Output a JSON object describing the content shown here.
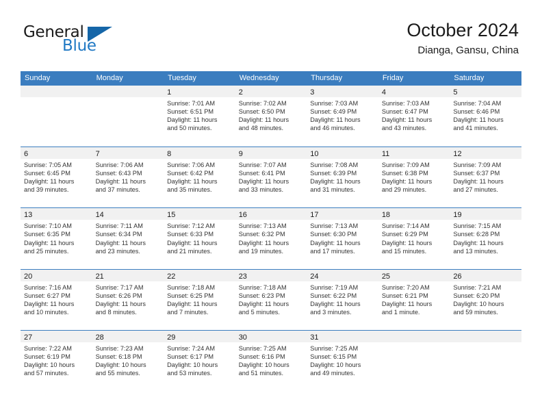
{
  "brand": {
    "name_line1": "General",
    "name_line2": "Blue",
    "accent_color": "#2079c4",
    "triangle_color": "#1566a8"
  },
  "header": {
    "title": "October 2024",
    "subtitle": "Dianga, Gansu, China"
  },
  "theme": {
    "header_bar_color": "#3b7dbf",
    "day_number_bar_color": "#f1f1f1",
    "text_color": "#333333"
  },
  "weekdays": [
    "Sunday",
    "Monday",
    "Tuesday",
    "Wednesday",
    "Thursday",
    "Friday",
    "Saturday"
  ],
  "weeks": [
    [
      {
        "day": "",
        "sunrise": "",
        "sunset": "",
        "daylight": "",
        "daylight2": ""
      },
      {
        "day": "",
        "sunrise": "",
        "sunset": "",
        "daylight": "",
        "daylight2": ""
      },
      {
        "day": "1",
        "sunrise": "Sunrise: 7:01 AM",
        "sunset": "Sunset: 6:51 PM",
        "daylight": "Daylight: 11 hours",
        "daylight2": "and 50 minutes."
      },
      {
        "day": "2",
        "sunrise": "Sunrise: 7:02 AM",
        "sunset": "Sunset: 6:50 PM",
        "daylight": "Daylight: 11 hours",
        "daylight2": "and 48 minutes."
      },
      {
        "day": "3",
        "sunrise": "Sunrise: 7:03 AM",
        "sunset": "Sunset: 6:49 PM",
        "daylight": "Daylight: 11 hours",
        "daylight2": "and 46 minutes."
      },
      {
        "day": "4",
        "sunrise": "Sunrise: 7:03 AM",
        "sunset": "Sunset: 6:47 PM",
        "daylight": "Daylight: 11 hours",
        "daylight2": "and 43 minutes."
      },
      {
        "day": "5",
        "sunrise": "Sunrise: 7:04 AM",
        "sunset": "Sunset: 6:46 PM",
        "daylight": "Daylight: 11 hours",
        "daylight2": "and 41 minutes."
      }
    ],
    [
      {
        "day": "6",
        "sunrise": "Sunrise: 7:05 AM",
        "sunset": "Sunset: 6:45 PM",
        "daylight": "Daylight: 11 hours",
        "daylight2": "and 39 minutes."
      },
      {
        "day": "7",
        "sunrise": "Sunrise: 7:06 AM",
        "sunset": "Sunset: 6:43 PM",
        "daylight": "Daylight: 11 hours",
        "daylight2": "and 37 minutes."
      },
      {
        "day": "8",
        "sunrise": "Sunrise: 7:06 AM",
        "sunset": "Sunset: 6:42 PM",
        "daylight": "Daylight: 11 hours",
        "daylight2": "and 35 minutes."
      },
      {
        "day": "9",
        "sunrise": "Sunrise: 7:07 AM",
        "sunset": "Sunset: 6:41 PM",
        "daylight": "Daylight: 11 hours",
        "daylight2": "and 33 minutes."
      },
      {
        "day": "10",
        "sunrise": "Sunrise: 7:08 AM",
        "sunset": "Sunset: 6:39 PM",
        "daylight": "Daylight: 11 hours",
        "daylight2": "and 31 minutes."
      },
      {
        "day": "11",
        "sunrise": "Sunrise: 7:09 AM",
        "sunset": "Sunset: 6:38 PM",
        "daylight": "Daylight: 11 hours",
        "daylight2": "and 29 minutes."
      },
      {
        "day": "12",
        "sunrise": "Sunrise: 7:09 AM",
        "sunset": "Sunset: 6:37 PM",
        "daylight": "Daylight: 11 hours",
        "daylight2": "and 27 minutes."
      }
    ],
    [
      {
        "day": "13",
        "sunrise": "Sunrise: 7:10 AM",
        "sunset": "Sunset: 6:35 PM",
        "daylight": "Daylight: 11 hours",
        "daylight2": "and 25 minutes."
      },
      {
        "day": "14",
        "sunrise": "Sunrise: 7:11 AM",
        "sunset": "Sunset: 6:34 PM",
        "daylight": "Daylight: 11 hours",
        "daylight2": "and 23 minutes."
      },
      {
        "day": "15",
        "sunrise": "Sunrise: 7:12 AM",
        "sunset": "Sunset: 6:33 PM",
        "daylight": "Daylight: 11 hours",
        "daylight2": "and 21 minutes."
      },
      {
        "day": "16",
        "sunrise": "Sunrise: 7:13 AM",
        "sunset": "Sunset: 6:32 PM",
        "daylight": "Daylight: 11 hours",
        "daylight2": "and 19 minutes."
      },
      {
        "day": "17",
        "sunrise": "Sunrise: 7:13 AM",
        "sunset": "Sunset: 6:30 PM",
        "daylight": "Daylight: 11 hours",
        "daylight2": "and 17 minutes."
      },
      {
        "day": "18",
        "sunrise": "Sunrise: 7:14 AM",
        "sunset": "Sunset: 6:29 PM",
        "daylight": "Daylight: 11 hours",
        "daylight2": "and 15 minutes."
      },
      {
        "day": "19",
        "sunrise": "Sunrise: 7:15 AM",
        "sunset": "Sunset: 6:28 PM",
        "daylight": "Daylight: 11 hours",
        "daylight2": "and 13 minutes."
      }
    ],
    [
      {
        "day": "20",
        "sunrise": "Sunrise: 7:16 AM",
        "sunset": "Sunset: 6:27 PM",
        "daylight": "Daylight: 11 hours",
        "daylight2": "and 10 minutes."
      },
      {
        "day": "21",
        "sunrise": "Sunrise: 7:17 AM",
        "sunset": "Sunset: 6:26 PM",
        "daylight": "Daylight: 11 hours",
        "daylight2": "and 8 minutes."
      },
      {
        "day": "22",
        "sunrise": "Sunrise: 7:18 AM",
        "sunset": "Sunset: 6:25 PM",
        "daylight": "Daylight: 11 hours",
        "daylight2": "and 7 minutes."
      },
      {
        "day": "23",
        "sunrise": "Sunrise: 7:18 AM",
        "sunset": "Sunset: 6:23 PM",
        "daylight": "Daylight: 11 hours",
        "daylight2": "and 5 minutes."
      },
      {
        "day": "24",
        "sunrise": "Sunrise: 7:19 AM",
        "sunset": "Sunset: 6:22 PM",
        "daylight": "Daylight: 11 hours",
        "daylight2": "and 3 minutes."
      },
      {
        "day": "25",
        "sunrise": "Sunrise: 7:20 AM",
        "sunset": "Sunset: 6:21 PM",
        "daylight": "Daylight: 11 hours",
        "daylight2": "and 1 minute."
      },
      {
        "day": "26",
        "sunrise": "Sunrise: 7:21 AM",
        "sunset": "Sunset: 6:20 PM",
        "daylight": "Daylight: 10 hours",
        "daylight2": "and 59 minutes."
      }
    ],
    [
      {
        "day": "27",
        "sunrise": "Sunrise: 7:22 AM",
        "sunset": "Sunset: 6:19 PM",
        "daylight": "Daylight: 10 hours",
        "daylight2": "and 57 minutes."
      },
      {
        "day": "28",
        "sunrise": "Sunrise: 7:23 AM",
        "sunset": "Sunset: 6:18 PM",
        "daylight": "Daylight: 10 hours",
        "daylight2": "and 55 minutes."
      },
      {
        "day": "29",
        "sunrise": "Sunrise: 7:24 AM",
        "sunset": "Sunset: 6:17 PM",
        "daylight": "Daylight: 10 hours",
        "daylight2": "and 53 minutes."
      },
      {
        "day": "30",
        "sunrise": "Sunrise: 7:25 AM",
        "sunset": "Sunset: 6:16 PM",
        "daylight": "Daylight: 10 hours",
        "daylight2": "and 51 minutes."
      },
      {
        "day": "31",
        "sunrise": "Sunrise: 7:25 AM",
        "sunset": "Sunset: 6:15 PM",
        "daylight": "Daylight: 10 hours",
        "daylight2": "and 49 minutes."
      },
      {
        "day": "",
        "sunrise": "",
        "sunset": "",
        "daylight": "",
        "daylight2": ""
      },
      {
        "day": "",
        "sunrise": "",
        "sunset": "",
        "daylight": "",
        "daylight2": ""
      }
    ]
  ]
}
